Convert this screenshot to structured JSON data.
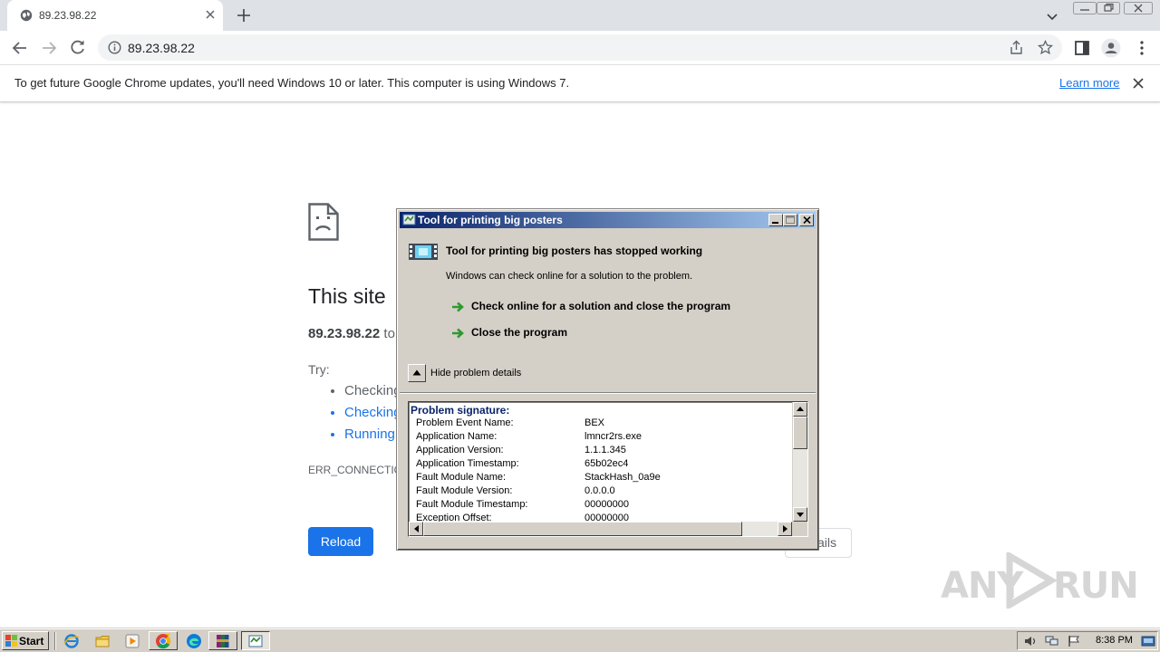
{
  "browser": {
    "tab_title": "89.23.98.22",
    "url": "89.23.98.22"
  },
  "infobar": {
    "message": "To get future Google Chrome updates, you'll need Windows 10 or later. This computer is using Windows 7.",
    "link": "Learn more"
  },
  "error_page": {
    "title": "This site",
    "subtitle_host": "89.23.98.22",
    "subtitle_rest": " to",
    "try_label": "Try:",
    "suggestions": [
      "Checking",
      "Checking",
      "Running"
    ],
    "error_code": "ERR_CONNECTION",
    "reload_label": "Reload",
    "details_label": "ails"
  },
  "dialog": {
    "title": "Tool for printing big posters",
    "heading": "Tool for printing big posters has stopped working",
    "subheading": "Windows can check online for a solution to the problem.",
    "action_check": "Check online for a solution and close the program",
    "action_close": "Close the program",
    "toggle_label": "Hide problem details",
    "details_heading": "Problem signature:",
    "details": [
      {
        "key": "Problem Event Name:",
        "value": "BEX"
      },
      {
        "key": "Application Name:",
        "value": "lmncr2rs.exe"
      },
      {
        "key": "Application Version:",
        "value": "1.1.1.345"
      },
      {
        "key": "Application Timestamp:",
        "value": "65b02ec4"
      },
      {
        "key": "Fault Module Name:",
        "value": "StackHash_0a9e"
      },
      {
        "key": "Fault Module Version:",
        "value": "0.0.0.0"
      },
      {
        "key": "Fault Module Timestamp:",
        "value": "00000000"
      },
      {
        "key": "Exception Offset:",
        "value": "00000000"
      }
    ]
  },
  "taskbar": {
    "start_label": "Start",
    "clock": "8:38 PM"
  },
  "watermark": {
    "left": "ANY",
    "right": "RUN"
  },
  "colors": {
    "chrome_blue": "#1a73e8",
    "tabstrip": "#dee1e6",
    "classic_face": "#d4d0c8",
    "titlebar_start": "#0a246a",
    "titlebar_end": "#a6caf0"
  }
}
